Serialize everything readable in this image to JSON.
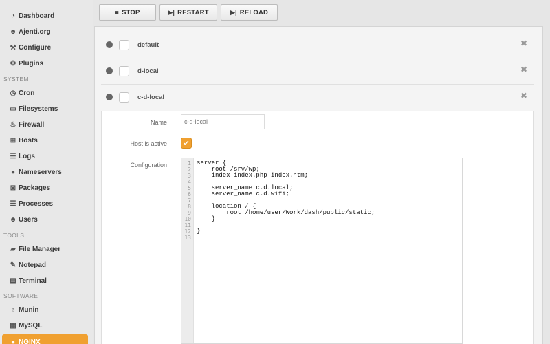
{
  "sidebar": {
    "items": [
      {
        "label": "Dashboard",
        "icon": "dashboard-icon"
      },
      {
        "label": "Ajenti.org",
        "icon": "users-icon"
      },
      {
        "label": "Configure",
        "icon": "wrench-icon"
      },
      {
        "label": "Plugins",
        "icon": "cogs-icon"
      }
    ],
    "system_header": "SYSTEM",
    "system_items": [
      {
        "label": "Cron",
        "icon": "clock-icon"
      },
      {
        "label": "Filesystems",
        "icon": "hdd-icon"
      },
      {
        "label": "Firewall",
        "icon": "fire-icon"
      },
      {
        "label": "Hosts",
        "icon": "sitemap-icon"
      },
      {
        "label": "Logs",
        "icon": "list-icon"
      },
      {
        "label": "Nameservers",
        "icon": "globe-icon"
      },
      {
        "label": "Packages",
        "icon": "gift-icon"
      },
      {
        "label": "Processes",
        "icon": "list-icon"
      },
      {
        "label": "Users",
        "icon": "users-icon"
      }
    ],
    "tools_header": "TOOLS",
    "tools_items": [
      {
        "label": "File Manager",
        "icon": "folder-icon"
      },
      {
        "label": "Notepad",
        "icon": "edit-icon"
      },
      {
        "label": "Terminal",
        "icon": "terminal-icon"
      }
    ],
    "software_header": "SOFTWARE",
    "software_items": [
      {
        "label": "Munin",
        "icon": "stethoscope-icon"
      },
      {
        "label": "MySQL",
        "icon": "table-icon"
      },
      {
        "label": "NGINX",
        "icon": "globe-icon",
        "active": true
      }
    ]
  },
  "toolbar": {
    "stop_label": "STOP",
    "restart_label": "RESTART",
    "reload_label": "RELOAD"
  },
  "hosts": [
    {
      "name": "default",
      "expanded": false
    },
    {
      "name": "d-local",
      "expanded": false
    },
    {
      "name": "c-d-local",
      "expanded": true
    }
  ],
  "form": {
    "name_label": "Name",
    "name_value": "c-d-local",
    "active_label": "Host is active",
    "active_checked": true,
    "config_label": "Configuration"
  },
  "editor": {
    "line_numbers": [
      "1",
      "2",
      "3",
      "4",
      "5",
      "6",
      "7",
      "8",
      "9",
      "10",
      "11",
      "12",
      "13"
    ],
    "lines": [
      "server {",
      "    root /srv/wp;",
      "    index index.php index.htm;",
      "",
      "    server_name c.d.local;",
      "    server_name c.d.wifi;",
      "",
      "    location / {",
      "        root /home/user/Work/dash/public/static;",
      "    }",
      "",
      "}",
      ""
    ]
  },
  "colors": {
    "accent": "#f0a030",
    "sidebar_bg": "#e8e8e8"
  }
}
